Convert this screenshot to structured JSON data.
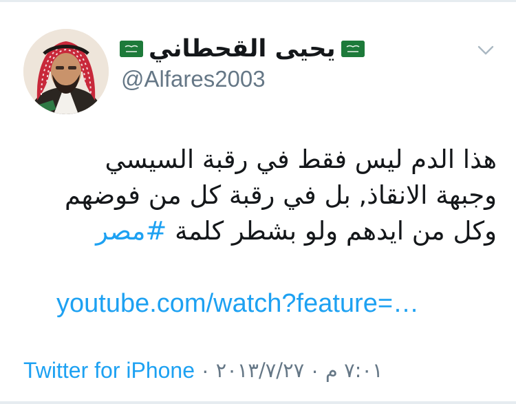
{
  "user": {
    "display_name": "يحيى القحطاني",
    "handle": "@Alfares2003"
  },
  "icons": {
    "flag": "saudi-flag-emoji",
    "menu": "chevron-down-icon",
    "avatar": "profile-photo"
  },
  "tweet": {
    "line1": "هذا الدم ليس فقط في رقبة السيسي",
    "line2": "وجبهة الانقاذ, بل في رقبة كل من فوضهم",
    "line3_text": "وكل من ايدهم ولو بشطر كلمة ",
    "hashtag": "#مصر",
    "link": "youtube.com/watch?feature=…"
  },
  "meta": {
    "time": "٧:٠١ م",
    "date": "٢٠١٣/٧/٢٧",
    "separator": "·",
    "source": "Twitter for iPhone"
  },
  "colors": {
    "link": "#1da1f2",
    "secondary": "#657786",
    "text": "#14171a",
    "flag_green": "#1d7a3a"
  }
}
